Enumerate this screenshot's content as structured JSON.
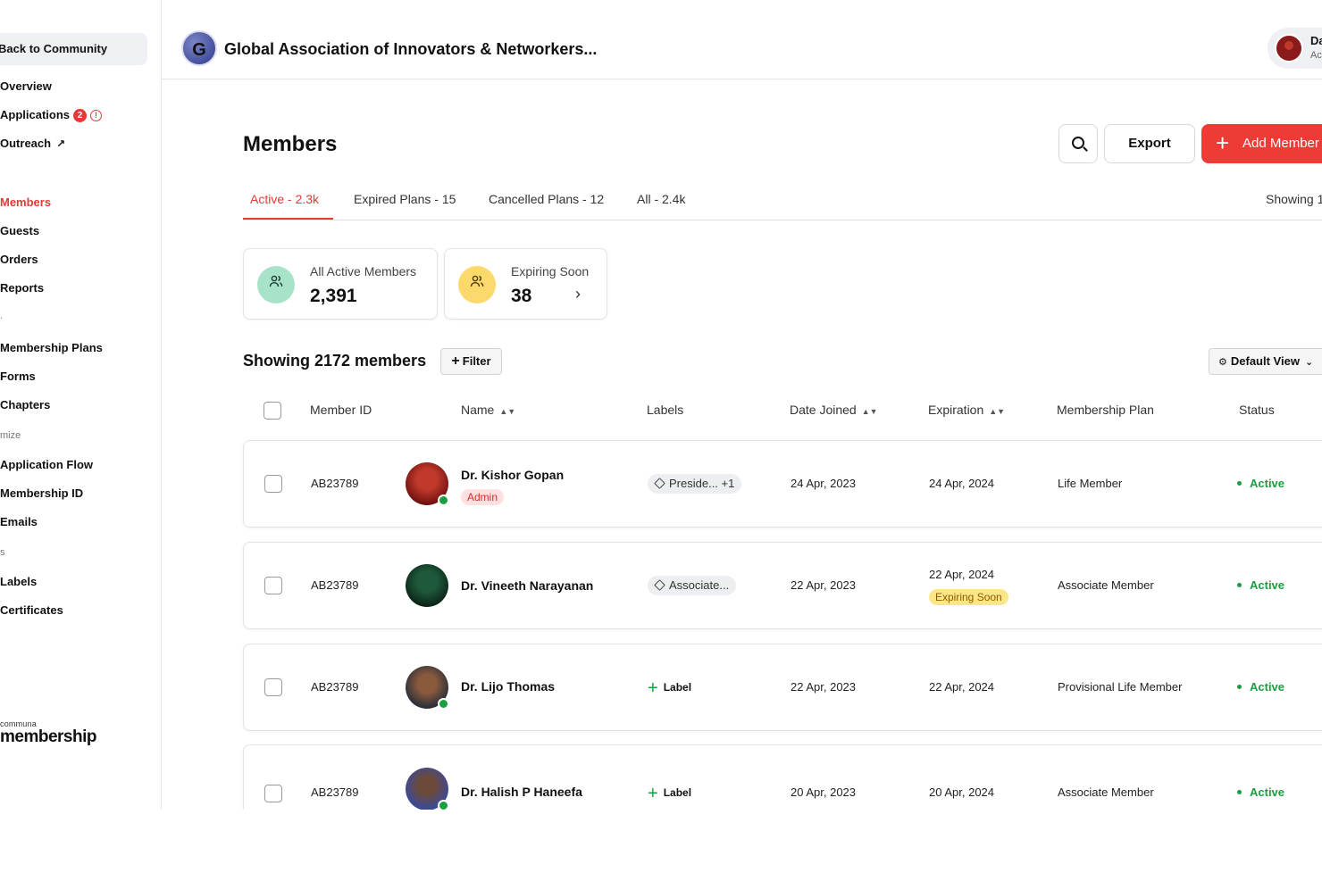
{
  "sidebar": {
    "back_label": "Back to Community",
    "items": [
      {
        "label": "Overview"
      },
      {
        "label": "Applications",
        "badge": "2"
      },
      {
        "label": "Outreach"
      },
      {
        "label": "Members",
        "active": true
      },
      {
        "label": "Guests"
      },
      {
        "label": "Orders"
      },
      {
        "label": "Reports"
      },
      {
        "label": "Membership Plans"
      },
      {
        "label": "Forms"
      },
      {
        "label": "Chapters"
      },
      {
        "label": "Application Flow"
      },
      {
        "label": "Membership ID"
      },
      {
        "label": "Emails"
      },
      {
        "label": "Labels"
      },
      {
        "label": "Certificates"
      }
    ],
    "section_1": ".",
    "section_2": "mize",
    "section_3": "s",
    "brand_small": "communa",
    "brand_big": "membership"
  },
  "header": {
    "org_initial": "G",
    "org_name": "Global Association of Innovators & Networkers...",
    "user_name": "Da",
    "user_role": "Ac"
  },
  "main": {
    "title": "Members",
    "export_label": "Export",
    "add_label": "Add Member",
    "tabs": [
      {
        "label": "Active - 2.3k"
      },
      {
        "label": "Expired Plans - 15"
      },
      {
        "label": "Cancelled Plans - 12"
      },
      {
        "label": "All - 2.4k"
      }
    ],
    "showing_right": "Showing 1",
    "stats": [
      {
        "label": "All Active Members",
        "value": "2,391"
      },
      {
        "label": "Expiring Soon",
        "value": "38"
      }
    ],
    "showing_count": "Showing 2172 members",
    "filter_label": "Filter",
    "view_label": "Default View"
  },
  "table": {
    "headers": {
      "member_id": "Member ID",
      "name": "Name",
      "labels": "Labels",
      "date_joined": "Date Joined",
      "expiration": "Expiration",
      "plan": "Membership Plan",
      "status": "Status"
    },
    "rows": [
      {
        "id": "AB23789",
        "name": "Dr. Kishor Gopan",
        "tag": "Admin",
        "label": "Preside... +1",
        "joined": "24 Apr, 2023",
        "expiration": "24 Apr, 2024",
        "plan": "Life Member",
        "status": "Active"
      },
      {
        "id": "AB23789",
        "name": "Dr. Vineeth Narayanan",
        "label": "Associate...",
        "joined": "22 Apr, 2023",
        "expiration": "22 Apr, 2024",
        "exp_tag": "Expiring Soon",
        "plan": "Associate Member",
        "status": "Active"
      },
      {
        "id": "AB23789",
        "name": "Dr. Lijo Thomas",
        "label": "Label",
        "joined": "22 Apr, 2023",
        "expiration": "22 Apr, 2024",
        "plan": "Provisional Life Member",
        "status": "Active"
      },
      {
        "id": "AB23789",
        "name": "Dr. Halish P Haneefa",
        "label": "Label",
        "joined": "20 Apr, 2023",
        "expiration": "20 Apr, 2024",
        "plan": "Associate Member",
        "status": "Active"
      }
    ]
  },
  "colors": {
    "accent": "#e53935",
    "active_green": "#1a9e3f",
    "stat_green_bg": "#a6e3c9",
    "stat_yellow_bg": "#fcd96b"
  }
}
